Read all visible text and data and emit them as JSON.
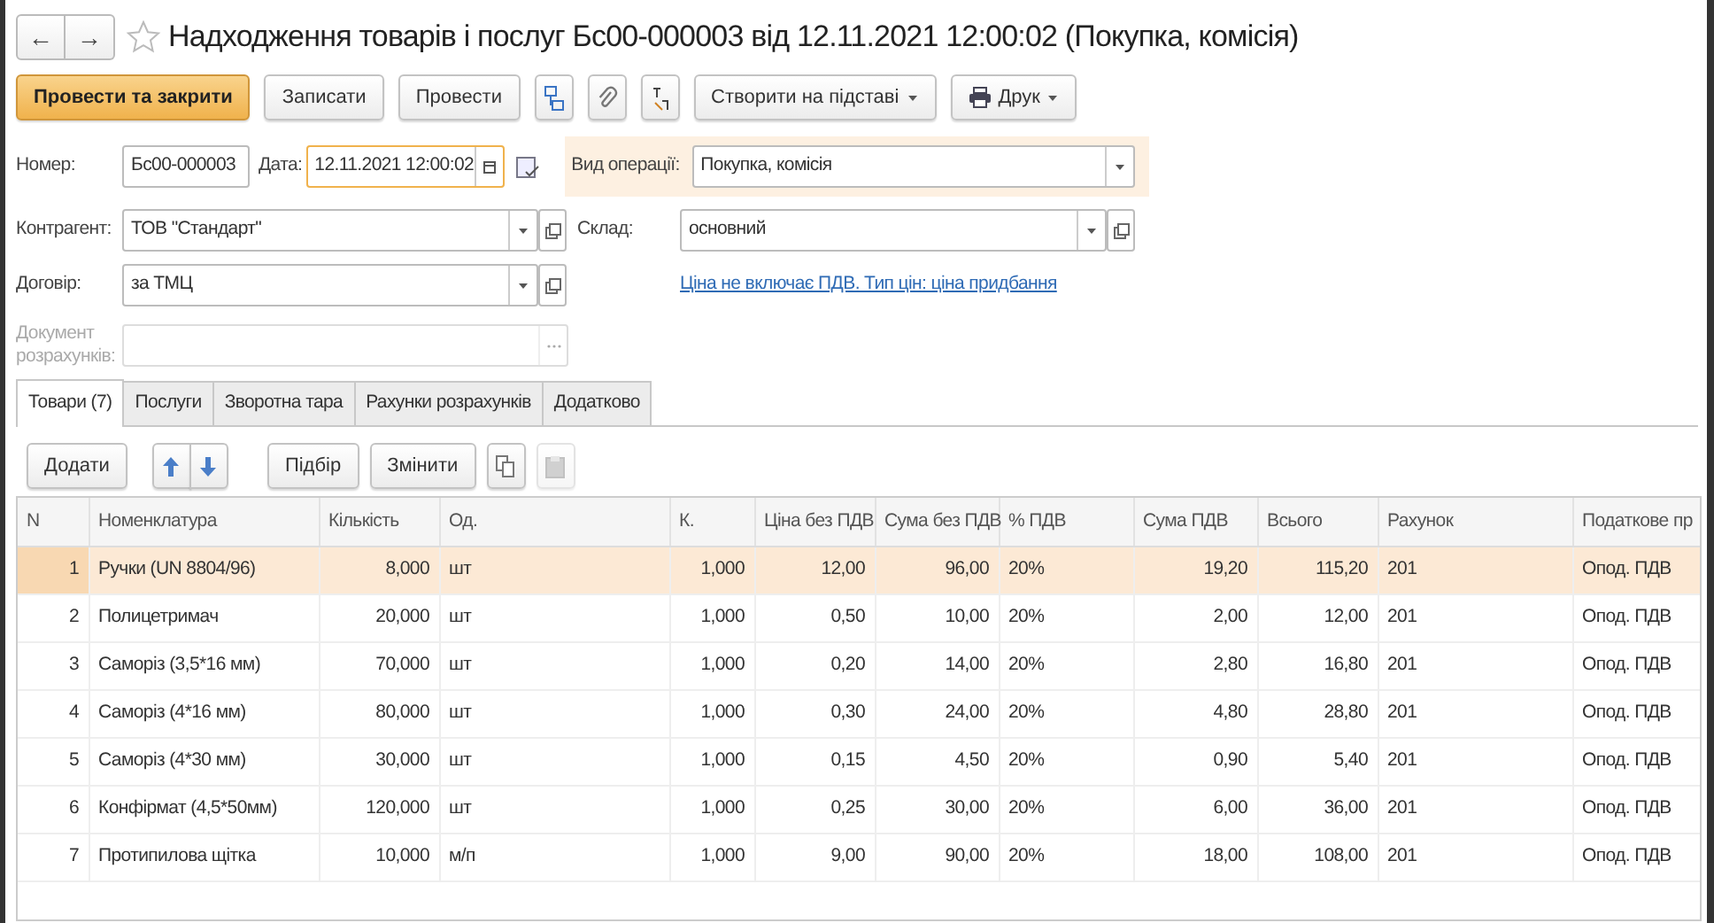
{
  "nav": {
    "back": "←",
    "forward": "→",
    "favorite": false
  },
  "title": "Надходження товарів і послуг Бс00-000003 від 12.11.2021 12:00:02 (Покупка, комісія)",
  "toolbar": [
    {
      "kind": "primary",
      "label": "Провести та закрити"
    },
    {
      "kind": "button",
      "label": "Записати"
    },
    {
      "kind": "button",
      "label": "Провести"
    },
    {
      "kind": "icon"
    },
    {
      "kind": "icon"
    },
    {
      "kind": "icon"
    },
    {
      "kind": "dropdown",
      "label": "Створити на підставі"
    },
    {
      "kind": "print",
      "label": "Друк"
    }
  ],
  "header": {
    "number_label": "Номер:",
    "number": "Бс00-000003",
    "date_label": "Дата:",
    "date": "12.11.2021 12:00:02",
    "operation_label": "Вид операції:",
    "operation": "Покупка, комісія",
    "counterparty_label": "Контрагент:",
    "counterparty": "ТОВ \"Стандарт\"",
    "warehouse_label": "Склад:",
    "warehouse": "основний",
    "contract_label": "Договір:",
    "contract": "за ТМЦ",
    "price_link": "Ціна не включає ПДВ. Тип цін: ціна придбання",
    "settlement_label": "Документ розрахунків:",
    "settlement_disabled": true
  },
  "tabs": [
    {
      "label": "Товари (7)",
      "selected": true
    },
    {
      "label": "Послуги",
      "selected": false
    },
    {
      "label": "Зворотна тара",
      "selected": false
    },
    {
      "label": "Рахунки розрахунків",
      "selected": false
    },
    {
      "label": "Додатково",
      "selected": false
    }
  ],
  "table_toolbar": [
    {
      "kind": "button",
      "label": "Додати"
    },
    {
      "kind": "up"
    },
    {
      "kind": "down"
    },
    {
      "kind": "button",
      "label": "Підбір"
    },
    {
      "kind": "button",
      "label": "Змінити"
    },
    {
      "kind": "copy",
      "disabled": false
    },
    {
      "kind": "paste",
      "disabled": true
    }
  ],
  "table": {
    "columns": [
      {
        "label": "N"
      },
      {
        "label": "Номенклатура"
      },
      {
        "label": "Кількість"
      },
      {
        "label": "Од."
      },
      {
        "label": "К."
      },
      {
        "label": "Ціна без ПДВ"
      },
      {
        "label": "Сума без ПДВ"
      },
      {
        "label": "% ПДВ"
      },
      {
        "label": "Сума ПДВ"
      },
      {
        "label": "Всього"
      },
      {
        "label": "Рахунок"
      },
      {
        "label": "Податкове пр"
      }
    ],
    "rows": [
      {
        "selected": true,
        "cells": [
          "1",
          "Ручки (UN 8804/96)",
          "8,000",
          "шт",
          "1,000",
          "12,00",
          "96,00",
          "20%",
          "19,20",
          "115,20",
          "201",
          "Опод. ПДВ"
        ]
      },
      {
        "selected": false,
        "cells": [
          "2",
          "Полицетримач",
          "20,000",
          "шт",
          "1,000",
          "0,50",
          "10,00",
          "20%",
          "2,00",
          "12,00",
          "201",
          "Опод. ПДВ"
        ]
      },
      {
        "selected": false,
        "cells": [
          "3",
          "Саморіз (3,5*16 мм)",
          "70,000",
          "шт",
          "1,000",
          "0,20",
          "14,00",
          "20%",
          "2,80",
          "16,80",
          "201",
          "Опод. ПДВ"
        ]
      },
      {
        "selected": false,
        "cells": [
          "4",
          "Саморіз (4*16 мм)",
          "80,000",
          "шт",
          "1,000",
          "0,30",
          "24,00",
          "20%",
          "4,80",
          "28,80",
          "201",
          "Опод. ПДВ"
        ]
      },
      {
        "selected": false,
        "cells": [
          "5",
          "Саморіз (4*30 мм)",
          "30,000",
          "шт",
          "1,000",
          "0,15",
          "4,50",
          "20%",
          "0,90",
          "5,40",
          "201",
          "Опод. ПДВ"
        ]
      },
      {
        "selected": false,
        "cells": [
          "6",
          "Конфірмат (4,5*50мм)",
          "120,000",
          "шт",
          "1,000",
          "0,25",
          "30,00",
          "20%",
          "6,00",
          "36,00",
          "201",
          "Опод. ПДВ"
        ]
      },
      {
        "selected": false,
        "cells": [
          "7",
          "Протипилова щітка",
          "10,000",
          "м/п",
          "1,000",
          "9,00",
          "90,00",
          "20%",
          "18,00",
          "108,00",
          "201",
          "Опод. ПДВ"
        ]
      }
    ]
  }
}
